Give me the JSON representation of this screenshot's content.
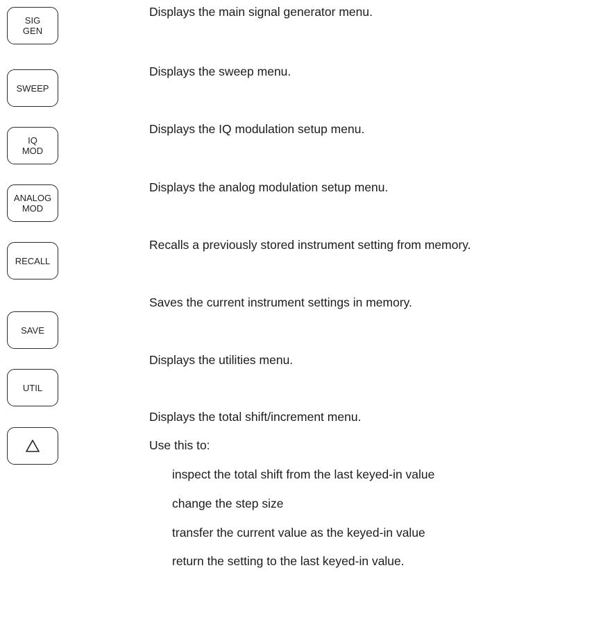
{
  "keys": [
    {
      "lines": [
        "SIG",
        "GEN"
      ],
      "description": "Displays the main signal generator menu."
    },
    {
      "lines": [
        "SWEEP",
        ""
      ],
      "description": "Displays the sweep menu."
    },
    {
      "lines": [
        "IQ",
        "MOD"
      ],
      "description": "Displays the IQ modulation setup menu."
    },
    {
      "lines": [
        "ANALOG",
        "MOD"
      ],
      "description": "Displays the analog modulation setup menu."
    },
    {
      "lines": [
        "RECALL",
        ""
      ],
      "description": "Recalls a previously stored instrument setting from memory."
    },
    {
      "lines": [
        "SAVE",
        ""
      ],
      "description": "Saves the current instrument settings in memory."
    },
    {
      "lines": [
        "UTIL",
        ""
      ],
      "description": "Displays the utilities menu."
    },
    {
      "icon": "delta-triangle-icon",
      "description": "Displays the total shift/increment menu."
    }
  ],
  "use_intro": "Use this to:",
  "use_items": [
    "inspect the total shift from the last keyed-in value",
    "change the step size",
    "transfer the current value as the keyed-in value",
    "return the setting to the last keyed-in value."
  ]
}
